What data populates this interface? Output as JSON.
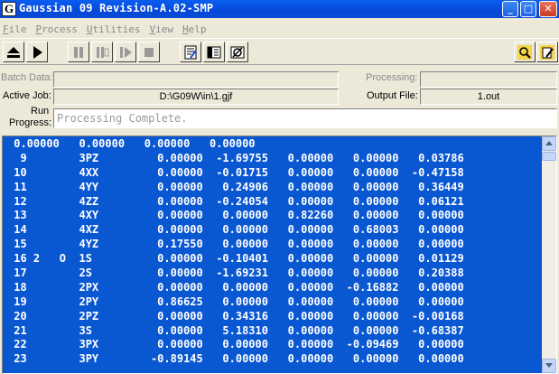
{
  "window": {
    "logo": "G",
    "title": "Gaussian 09 Revision-A.02-SMP",
    "controls": {
      "minimize": "_",
      "maximize": "□",
      "close": "✕"
    }
  },
  "menu": [
    {
      "key": "F",
      "rest": "ile"
    },
    {
      "key": "P",
      "rest": "rocess"
    },
    {
      "key": "U",
      "rest": "tilities"
    },
    {
      "key": "V",
      "rest": "iew"
    },
    {
      "key": "H",
      "rest": "elp"
    }
  ],
  "toolbar": {
    "icons": [
      "eject-icon",
      "play-icon",
      "pause-icon",
      "pause-after-link-icon",
      "skip-icon",
      "stop-icon",
      "edit-file-icon",
      "view-file-icon",
      "exit-icon",
      "search-icon",
      "notepad-icon"
    ]
  },
  "fields": {
    "batch_data_label": "Batch Data:",
    "batch_data_value": "",
    "processing_label": "Processing:",
    "processing_value": "",
    "active_job_label": "Active Job:",
    "active_job_value": "D:\\G09W\\in\\1.gjf",
    "output_file_label": "Output File:",
    "output_file_value": "1.out",
    "run_progress_label_1": "Run",
    "run_progress_label_2": "Progress:",
    "run_progress_value": "Processing Complete."
  },
  "output_lines": [
    " 0.00000   0.00000   0.00000   0.00000",
    "  9        3PZ         0.00000  -1.69755   0.00000   0.00000   0.03786",
    " 10        4XX         0.00000  -0.01715   0.00000   0.00000  -0.47158",
    " 11        4YY         0.00000   0.24906   0.00000   0.00000   0.36449",
    " 12        4ZZ         0.00000  -0.24054   0.00000   0.00000   0.06121",
    " 13        4XY         0.00000   0.00000   0.82260   0.00000   0.00000",
    " 14        4XZ         0.00000   0.00000   0.00000   0.68003   0.00000",
    " 15        4YZ         0.17550   0.00000   0.00000   0.00000   0.00000",
    " 16 2   O  1S          0.00000  -0.10401   0.00000   0.00000   0.01129",
    " 17        2S          0.00000  -1.69231   0.00000   0.00000   0.20388",
    " 18        2PX         0.00000   0.00000   0.00000  -0.16882   0.00000",
    " 19        2PY         0.86625   0.00000   0.00000   0.00000   0.00000",
    " 20        2PZ         0.00000   0.34316   0.00000   0.00000  -0.00168",
    " 21        3S          0.00000   5.18310   0.00000   0.00000  -0.68387",
    " 22        3PX         0.00000   0.00000   0.00000  -0.09469   0.00000",
    " 23        3PY        -0.89145   0.00000   0.00000   0.00000   0.00000"
  ],
  "colors": {
    "output_background": "#0a57d2",
    "output_text": "#ffffff",
    "titlebar": "#0548d8"
  }
}
